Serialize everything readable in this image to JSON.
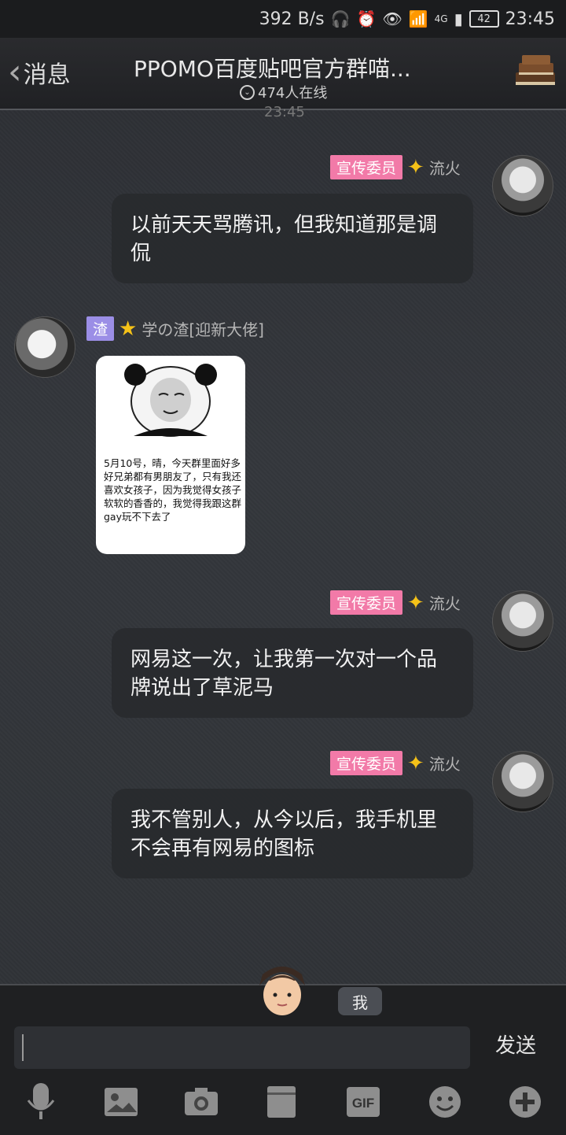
{
  "status_bar": {
    "speed": "392 B/s",
    "battery": "42",
    "time": "23:45",
    "network": "4G"
  },
  "header": {
    "back_label": "消息",
    "title": "PPOMO百度贴吧官方群喵...",
    "online": "474人在线"
  },
  "timestamp_stub": "23:45",
  "messages": [
    {
      "side": "right",
      "badge": "宣传委员",
      "name": "流火",
      "text": "以前天天骂腾讯，但我知道那是调侃"
    },
    {
      "side": "left",
      "badge": "渣",
      "name": "学の渣[迎新大佬]",
      "image_caption": "5月10号，晴，今天群里面好多好兄弟都有男朋友了，只有我还喜欢女孩子，因为我觉得女孩子软软的香香的，我觉得我跟这群gay玩不下去了"
    },
    {
      "side": "right",
      "badge": "宣传委员",
      "name": "流火",
      "text": "网易这一次，让我第一次对一个品牌说出了草泥马"
    },
    {
      "side": "right",
      "badge": "宣传委员",
      "name": "流火",
      "text": "我不管别人，从今以后，我手机里不会再有网易的图标"
    }
  ],
  "composer": {
    "me_label": "我",
    "send_label": "发送"
  },
  "toolbar": {
    "icons": [
      "microphone-icon",
      "image-icon",
      "camera-icon",
      "folder-icon",
      "gif-icon",
      "emoji-icon",
      "plus-icon"
    ],
    "gif_text": "GIF"
  },
  "colors": {
    "badge_pink": "#f27aa8",
    "badge_purple": "#9b8ee6",
    "star": "#f5c218"
  }
}
